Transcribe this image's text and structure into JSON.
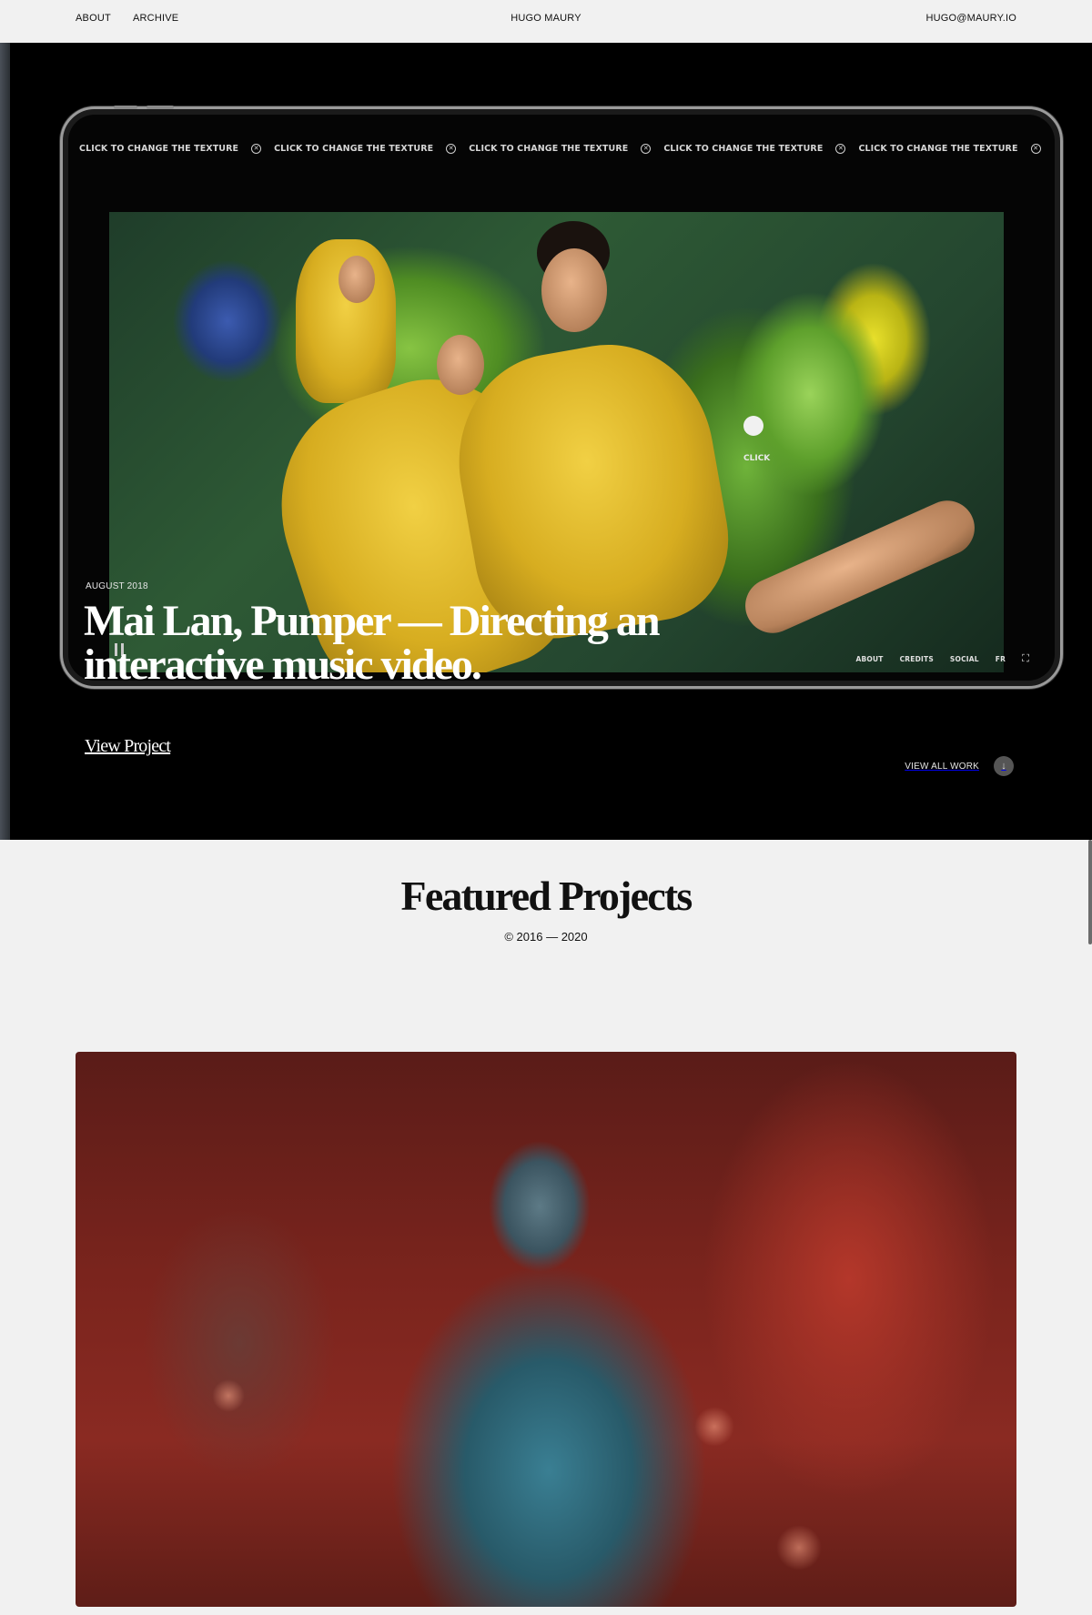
{
  "nav": {
    "about": "ABOUT",
    "archive": "ARCHIVE",
    "brand": "HUGO MAURY",
    "email": "HUGO@MAURY.IO"
  },
  "hero": {
    "marquee_text": "CLICK TO CHANGE THE TEXTURE",
    "marquee_icon": "circle-x-icon",
    "cursor_label": "CLICK",
    "device_menu": [
      "ABOUT",
      "CREDITS",
      "SOCIAL",
      "FR"
    ],
    "fullscreen_icon": "fullscreen-icon",
    "date": "AUGUST 2018",
    "title": "Mai Lan, Pumper — Directing an interactive music video.",
    "view_project": "View Project",
    "view_all": "VIEW ALL WORK",
    "arrow_icon": "arrow-down-icon"
  },
  "featured": {
    "title": "Featured Projects",
    "years": "© 2016 — 2020"
  },
  "colors": {
    "background": "#f1f1f1",
    "hero_background": "#000000",
    "text": "#111111"
  }
}
